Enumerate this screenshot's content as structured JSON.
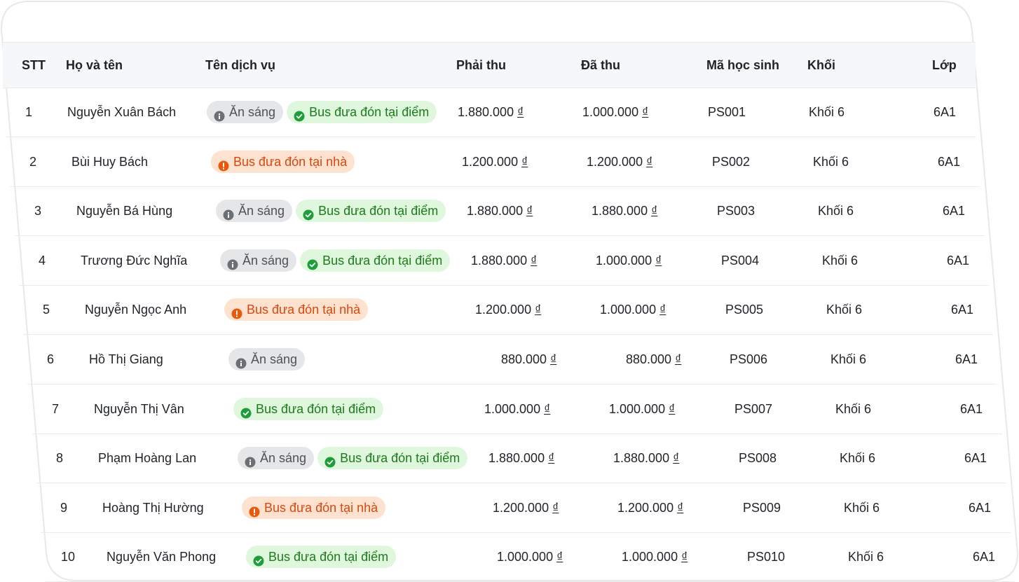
{
  "colors": {
    "header_bg": "#f6f7f9",
    "border": "#e9ebee",
    "tag_gray_bg": "#e5e6e8",
    "tag_gray_fg": "#4d5158",
    "tag_green_bg": "#dff7dc",
    "tag_green_fg": "#1f7a1f",
    "tag_orange_bg": "#fde2cf",
    "tag_orange_fg": "#d9480f"
  },
  "table": {
    "columns": {
      "stt": "STT",
      "name": "Họ và tên",
      "service": "Tên dịch vụ",
      "due": "Phải thu",
      "paid": "Đã thu",
      "student_id": "Mã học sinh",
      "grade": "Khối",
      "class": "Lớp"
    },
    "rows": [
      {
        "stt": "1",
        "name": "Nguyễn Xuân Bách",
        "tags": [
          {
            "label": "Ăn sáng",
            "kind": "gray",
            "icon": "info-icon"
          },
          {
            "label": "Bus đưa đón tại điểm",
            "kind": "green",
            "icon": "check-circle-icon"
          }
        ],
        "due": "1.880.000",
        "paid": "1.000.000",
        "currency": "₫",
        "student_id": "PS001",
        "grade": "Khối 6",
        "class": "6A1"
      },
      {
        "stt": "2",
        "name": "Bùi Huy Bách",
        "tags": [
          {
            "label": "Bus đưa đón tại nhà",
            "kind": "orange",
            "icon": "alert-circle-icon"
          }
        ],
        "due": "1.200.000",
        "paid": "1.200.000",
        "currency": "₫",
        "student_id": "PS002",
        "grade": "Khối 6",
        "class": "6A1"
      },
      {
        "stt": "3",
        "name": "Nguyễn Bá Hùng",
        "tags": [
          {
            "label": "Ăn sáng",
            "kind": "gray",
            "icon": "info-icon"
          },
          {
            "label": "Bus đưa đón tại điểm",
            "kind": "green",
            "icon": "check-circle-icon"
          }
        ],
        "due": "1.880.000",
        "paid": "1.880.000",
        "currency": "₫",
        "student_id": "PS003",
        "grade": "Khối 6",
        "class": "6A1"
      },
      {
        "stt": "4",
        "name": "Trương Đức Nghĩa",
        "tags": [
          {
            "label": "Ăn sáng",
            "kind": "gray",
            "icon": "info-icon"
          },
          {
            "label": "Bus đưa đón tại điểm",
            "kind": "green",
            "icon": "check-circle-icon"
          }
        ],
        "due": "1.880.000",
        "paid": "1.000.000",
        "currency": "₫",
        "student_id": "PS004",
        "grade": "Khối 6",
        "class": "6A1"
      },
      {
        "stt": "5",
        "name": "Nguyễn Ngọc Anh",
        "tags": [
          {
            "label": "Bus đưa đón tại nhà",
            "kind": "orange",
            "icon": "alert-circle-icon"
          }
        ],
        "due": "1.200.000",
        "paid": "1.000.000",
        "currency": "₫",
        "student_id": "PS005",
        "grade": "Khối 6",
        "class": "6A1"
      },
      {
        "stt": "6",
        "name": "Hồ Thị Giang",
        "tags": [
          {
            "label": "Ăn sáng",
            "kind": "gray",
            "icon": "info-icon"
          }
        ],
        "due": "880.000",
        "paid": "880.000",
        "currency": "₫",
        "student_id": "PS006",
        "grade": "Khối 6",
        "class": "6A1"
      },
      {
        "stt": "7",
        "name": "Nguyễn Thị Vân",
        "tags": [
          {
            "label": "Bus đưa đón tại điểm",
            "kind": "green",
            "icon": "check-circle-icon"
          }
        ],
        "due": "1.000.000",
        "paid": "1.000.000",
        "currency": "₫",
        "student_id": "PS007",
        "grade": "Khối 6",
        "class": "6A1"
      },
      {
        "stt": "8",
        "name": "Phạm Hoàng Lan",
        "tags": [
          {
            "label": "Ăn sáng",
            "kind": "gray",
            "icon": "info-icon"
          },
          {
            "label": "Bus đưa đón tại điểm",
            "kind": "green",
            "icon": "check-circle-icon"
          }
        ],
        "due": "1.880.000",
        "paid": "1.880.000",
        "currency": "₫",
        "student_id": "PS008",
        "grade": "Khối 6",
        "class": "6A1"
      },
      {
        "stt": "9",
        "name": "Hoàng Thị Hường",
        "tags": [
          {
            "label": "Bus đưa đón tại nhà",
            "kind": "orange",
            "icon": "alert-circle-icon"
          }
        ],
        "due": "1.200.000",
        "paid": "1.200.000",
        "currency": "₫",
        "student_id": "PS009",
        "grade": "Khối 6",
        "class": "6A1"
      },
      {
        "stt": "10",
        "name": "Nguyễn Văn Phong",
        "tags": [
          {
            "label": "Bus đưa đón tại điểm",
            "kind": "green",
            "icon": "check-circle-icon"
          }
        ],
        "due": "1.000.000",
        "paid": "1.000.000",
        "currency": "₫",
        "student_id": "PS010",
        "grade": "Khối 6",
        "class": "6A1"
      }
    ]
  }
}
